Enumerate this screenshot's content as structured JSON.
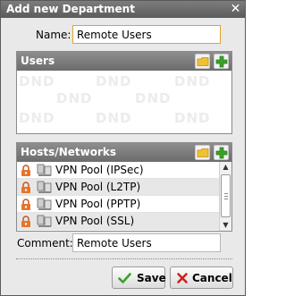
{
  "dialog": {
    "title": "Add new Department"
  },
  "name_field": {
    "label": "Name:",
    "value": "Remote Users"
  },
  "users_panel": {
    "title": "Users",
    "watermark": "DND"
  },
  "hosts_panel": {
    "title": "Hosts/Networks",
    "items": [
      {
        "label": "VPN Pool (IPSec)"
      },
      {
        "label": "VPN Pool (L2TP)"
      },
      {
        "label": "VPN Pool (PPTP)"
      },
      {
        "label": "VPN Pool (SSL)"
      }
    ]
  },
  "comment_field": {
    "label": "Comment:",
    "value": "Remote Users"
  },
  "buttons": {
    "save": "Save",
    "cancel": "Cancel"
  },
  "colors": {
    "accent_border": "#e3a32b",
    "header": "#7a7a7a",
    "add_green": "#3aa12a",
    "cancel_red": "#d22020"
  }
}
